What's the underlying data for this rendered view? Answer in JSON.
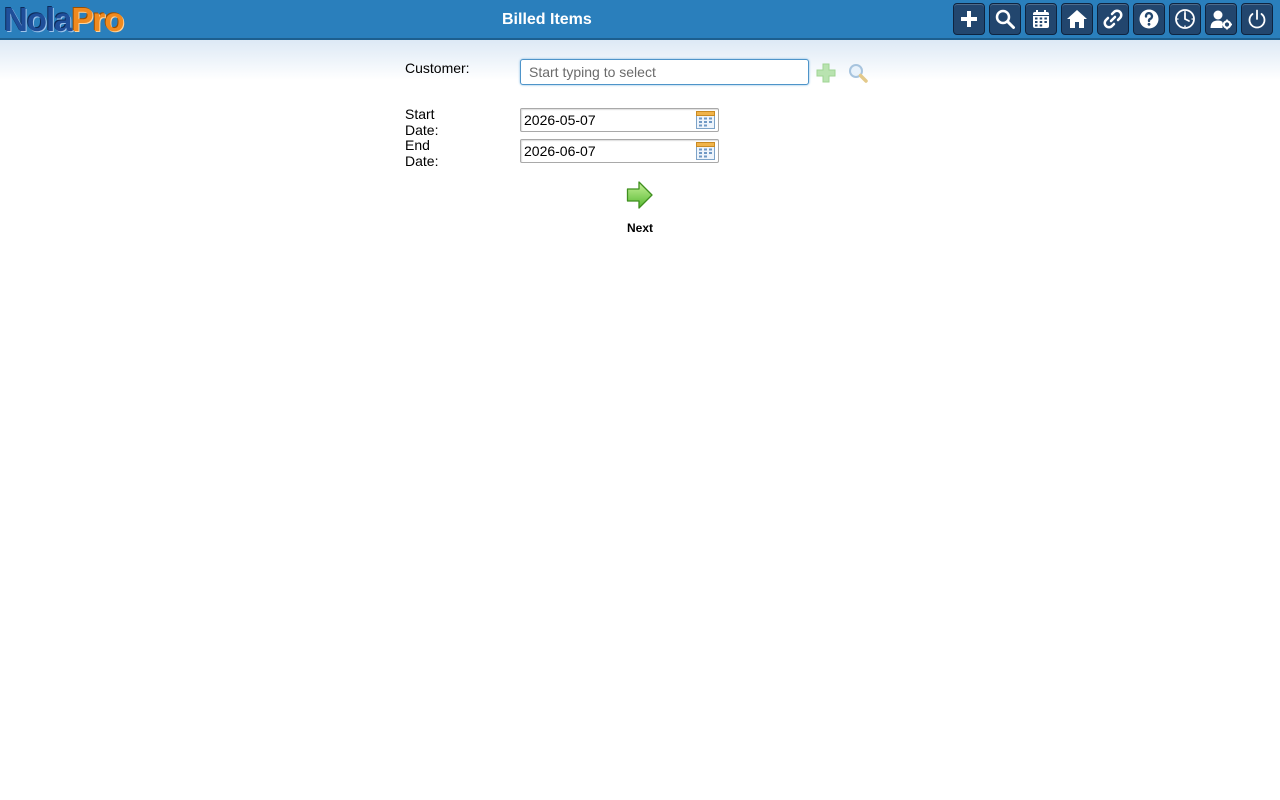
{
  "app": {
    "logo_part1": "Nola",
    "logo_part2": "Pro",
    "page_title": "Billed Items"
  },
  "toolbar": {
    "buttons": [
      {
        "name": "add-icon"
      },
      {
        "name": "search-icon"
      },
      {
        "name": "calendar-icon"
      },
      {
        "name": "home-icon"
      },
      {
        "name": "link-icon"
      },
      {
        "name": "help-icon"
      },
      {
        "name": "clock-icon"
      },
      {
        "name": "user-settings-icon"
      },
      {
        "name": "power-icon"
      }
    ]
  },
  "form": {
    "customer_label": "Customer:",
    "customer_placeholder": "Start typing to select",
    "customer_value": "",
    "start_date_label": "Start Date:",
    "start_date_value": "2026-05-07",
    "end_date_label": "End Date:",
    "end_date_value": "2026-06-07",
    "next_label": "Next"
  },
  "colors": {
    "header": "#2a7fbc",
    "toolbar_button": "#22466e",
    "input_focus_border": "#4e94c9"
  }
}
